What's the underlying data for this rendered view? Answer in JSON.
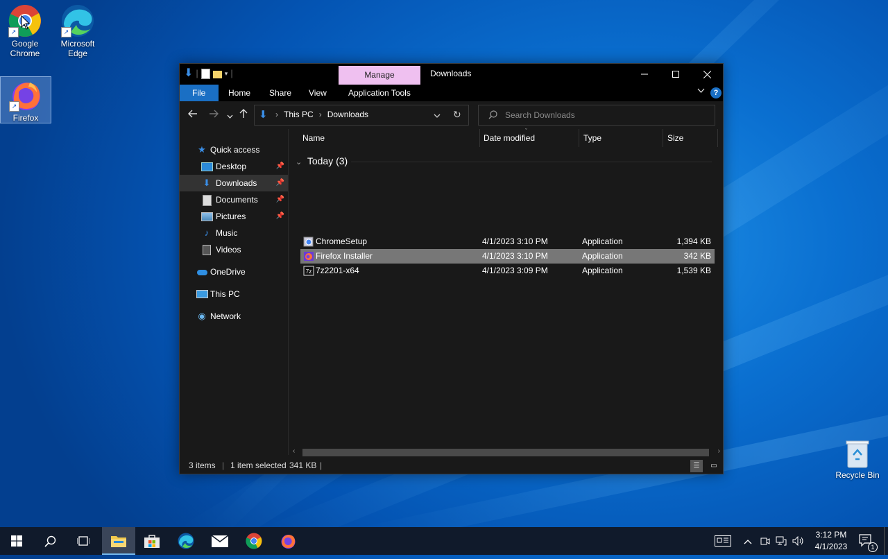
{
  "desktop": {
    "icons": [
      {
        "label_line1": "Google",
        "label_line2": "Chrome",
        "shortcut": "↗"
      },
      {
        "label_line1": "Microsoft",
        "label_line2": "Edge",
        "shortcut": "↗"
      },
      {
        "label_line1": "Firefox",
        "label_line2": "",
        "shortcut": "↗"
      },
      {
        "label_line1": "Recycle Bin",
        "label_line2": ""
      }
    ]
  },
  "window": {
    "title": "Downloads",
    "manage_tab": "Manage",
    "ribbon_tabs": {
      "file": "File",
      "home": "Home",
      "share": "Share",
      "view": "View",
      "app_tools": "Application Tools"
    },
    "help": "?",
    "address": {
      "root": "This PC",
      "current": "Downloads"
    },
    "search_placeholder": "Search Downloads",
    "nav": {
      "quick_access": "Quick access",
      "desktop": "Desktop",
      "downloads": "Downloads",
      "documents": "Documents",
      "pictures": "Pictures",
      "music": "Music",
      "videos": "Videos",
      "onedrive": "OneDrive",
      "this_pc": "This PC",
      "network": "Network"
    },
    "columns": {
      "name": "Name",
      "date": "Date modified",
      "type": "Type",
      "size": "Size"
    },
    "group_label": "Today (3)",
    "files": [
      {
        "name": "ChromeSetup",
        "date": "4/1/2023 3:10 PM",
        "type": "Application",
        "size": "1,394 KB"
      },
      {
        "name": "Firefox Installer",
        "date": "4/1/2023 3:10 PM",
        "type": "Application",
        "size": "342 KB"
      },
      {
        "name": "7z2201-x64",
        "date": "4/1/2023 3:09 PM",
        "type": "Application",
        "size": "1,539 KB"
      }
    ],
    "status": {
      "items": "3 items",
      "selected": "1 item selected",
      "size": "341 KB"
    }
  },
  "taskbar": {
    "clock_time": "3:12 PM",
    "clock_date": "4/1/2023",
    "notification_count": "1"
  },
  "colors": {
    "accent": "#1a6fc4",
    "manage_tab": "#efc0f0",
    "taskbar": "#101a2b",
    "selection_row": "#777777"
  }
}
